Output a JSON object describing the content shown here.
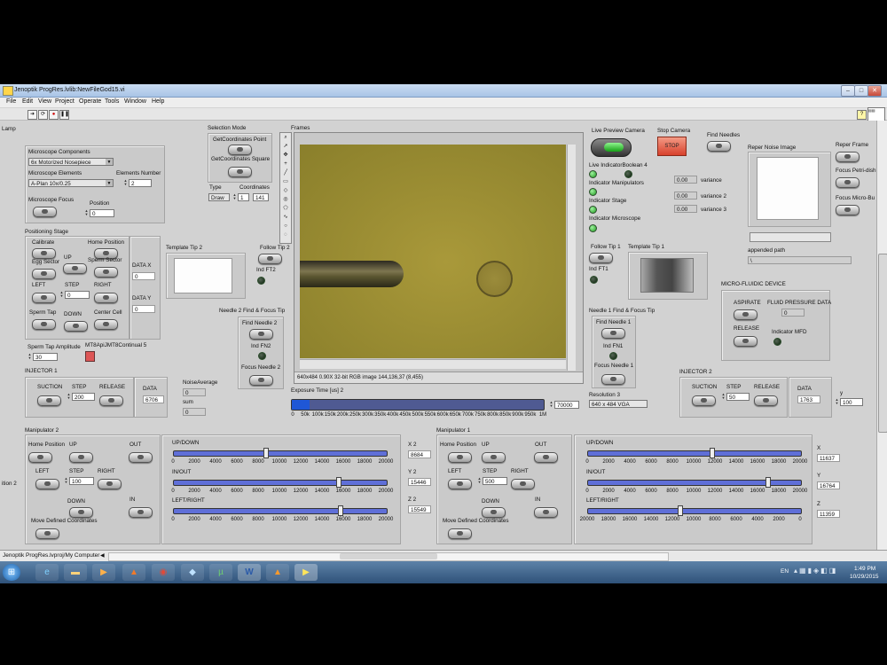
{
  "window": {
    "title": "Jenoptik ProgRes.lvlib:NewFileGod15.vi",
    "controls": {
      "min": "‒",
      "max": "□",
      "close": "✕"
    }
  },
  "menu": [
    "File",
    "Edit",
    "View",
    "Project",
    "Operate",
    "Tools",
    "Window",
    "Help"
  ],
  "toolbar": {
    "icons": [
      "run-arrow",
      "run-continuous",
      "abort",
      "pause"
    ]
  },
  "left_edge_labels": {
    "lamp": "Lamp",
    "position2": "ition 2"
  },
  "microscope": {
    "title": "Microscope Components",
    "components_value": "6x Motorized Nosepiece",
    "elements_label": "Microscope Elements",
    "elements_value": "A-Plan 10x/0.25",
    "elements_number_label": "Elements Number",
    "elements_number": "2",
    "focus_label": "Microscope Focus",
    "position_label": "Position",
    "position_value": "0"
  },
  "selection_mode": {
    "title": "Selection Mode",
    "get_point": "GetCoordinates Point",
    "get_square": "GetCoordinates Square",
    "type_label": "Type",
    "type_value": "Draw",
    "coords_label": "Coordinates",
    "coords_value": "1",
    "coords_value2": "141"
  },
  "positioning": {
    "title": "Positioning Stage",
    "calibrate": "Calibrate",
    "home_position": "Home Position",
    "up": "UP",
    "egg_sector": "Egg Sector",
    "sperm_sector": "Sperm Sector",
    "left": "LEFT",
    "step": "STEP",
    "step_value": "0",
    "right": "RIGHT",
    "sperm_tap": "Sperm Tap",
    "down": "DOWN",
    "center_cell": "Center Cell",
    "data_x_label": "DATA X",
    "data_x": "0",
    "data_y_label": "DATA Y",
    "data_y": "0",
    "amplitude_label": "Sperm Tap Amplitude",
    "amplitude_value": "30",
    "mt8_label": "MT8ApiJMT8Continual 5"
  },
  "template_tip2": {
    "title": "Template Tip 2"
  },
  "follow_tip2": {
    "title": "Follow Tip 2",
    "ind": "Ind FT2"
  },
  "needle2": {
    "title": "Needle 2 Find & Focus Tip",
    "find": "Find Needle 2",
    "ind": "Ind FN2",
    "focus": "Focus Needle 2"
  },
  "frames": {
    "title": "Frames",
    "info": "640x484 0.90X 32-bit RGB image 144,136,37",
    "coords": "(8,455)"
  },
  "exposure": {
    "title": "Exposure Time [us] 2",
    "ticks": [
      "0",
      "50k",
      "100k",
      "150k",
      "200k",
      "250k",
      "300k",
      "350k",
      "400k",
      "450k",
      "500k",
      "550k",
      "600k",
      "650k",
      "700k",
      "750k",
      "800k",
      "850k",
      "900k",
      "950k",
      "1M"
    ],
    "value": "70000",
    "fraction": 0.07
  },
  "resolution": {
    "label": "Resolution 3",
    "value": "640 x 484 VGA"
  },
  "camera": {
    "live_preview": "Live Preview Camera",
    "stop_camera": "Stop Camera",
    "stop_label": "STOP",
    "find_needles": "Find Needles",
    "live_indicator": "Live IndicatorBoolean 4",
    "ind_manipulators": "Indicator Manipulators",
    "ind_stage": "Indicator Stage",
    "ind_microscope": "Indicator Microscope",
    "variance_value1": "0.00",
    "variance_label1": "variance",
    "variance_value2": "0.00",
    "variance_label2": "variance 2",
    "variance_value3": "0.00",
    "variance_label3": "variance 3"
  },
  "follow_tip1": {
    "title": "Follow Tip 1",
    "ind": "Ind FT1"
  },
  "template_tip1": {
    "title": "Template Tip 1"
  },
  "needle1": {
    "title": "Needle 1 Find & Focus Tip",
    "find": "Find Needle 1",
    "ind": "Ind FN1",
    "focus": "Focus Needle 1"
  },
  "reper": {
    "noise_title": "Reper Noise Image",
    "reper_frame": "Reper Frame",
    "focus_petri": "Focus Petri-dish",
    "focus_micro": "Focus Micro-Bu",
    "appended_label": "appended path",
    "appended_value": "\\"
  },
  "microfluidic": {
    "title": "MICRO-FLUIDIC DEVICE",
    "aspirate": "ASPIRATE",
    "pressure_label": "FLUID PRESSURE DATA",
    "pressure_value": "0",
    "release": "RELEASE",
    "indicator": "Indicator MFD"
  },
  "injector1": {
    "title": "INJECTOR 1",
    "suction": "SUCTION",
    "step": "STEP",
    "step_value": "200",
    "release": "RELEASE",
    "data_label": "DATA",
    "data_value": "6706"
  },
  "noise": {
    "label": "NoiseAverage",
    "value": "0",
    "sum_label": "sum",
    "sum_value": "0"
  },
  "injector2": {
    "title": "INJECTOR 2",
    "suction": "SUCTION",
    "step": "STEP",
    "step_value": "50",
    "release": "RELEASE",
    "data_label": "DATA",
    "data_value": "1763",
    "y_label": "y",
    "y_value": "100"
  },
  "manip2": {
    "title": "Manipulator 2",
    "home": "Home Position",
    "up": "UP",
    "out": "OUT",
    "left": "LEFT",
    "step": "STEP",
    "step_value": "100",
    "right": "RIGHT",
    "down": "DOWN",
    "in": "IN",
    "move_defined": "Move Defined Coordinates",
    "updown_label": "UP/DOWN",
    "inout_label": "IN/OUT",
    "leftright_label": "LEFT/RIGHT",
    "ticks": [
      "0",
      "2000",
      "4000",
      "6000",
      "8000",
      "10000",
      "12000",
      "14000",
      "16000",
      "18000",
      "20000"
    ],
    "updown_fraction": 0.43,
    "inout_fraction": 0.77,
    "leftright_fraction": 0.78,
    "x_label": "X 2",
    "x_value": "8684",
    "y_label": "Y 2",
    "y_value": "15446",
    "z_label": "Z 2",
    "z_value": "15549"
  },
  "manip1": {
    "title": "Manipulator 1",
    "home": "Home Position",
    "up": "UP",
    "out": "OUT",
    "left": "LEFT",
    "step": "STEP",
    "step_value": "500",
    "right": "RIGHT",
    "down": "DOWN",
    "in": "IN",
    "move_defined": "Move Defined Coordinates",
    "updown_label": "UP/DOWN",
    "inout_label": "IN/OUT",
    "leftright_label": "LEFT/RIGHT",
    "ticks": [
      "0",
      "2000",
      "4000",
      "6000",
      "8000",
      "10000",
      "12000",
      "14000",
      "16000",
      "18000",
      "20000"
    ],
    "ticks_reverse": [
      "20000",
      "18000",
      "16000",
      "14000",
      "12000",
      "10000",
      "8000",
      "6000",
      "4000",
      "2000",
      "0"
    ],
    "updown_fraction": 0.58,
    "inout_fraction": 0.84,
    "leftright_fraction": 0.43,
    "x_label": "X",
    "x_value": "11637",
    "y_label": "Y",
    "y_value": "16764",
    "z_label": "Z",
    "z_value": "11359"
  },
  "statusbar": {
    "path": "Jenoptik ProgRes.lvproj/My Computer"
  },
  "taskbar": {
    "lang": "EN",
    "time": "1:49 PM",
    "date": "10/29/2015",
    "apps": [
      "windows-orb",
      "ie-icon",
      "explorer-icon",
      "media-player-icon",
      "matlab-icon",
      "chrome-icon",
      "tool-icon",
      "utorrent-icon",
      "word-icon",
      "vlc-icon",
      "labview-icon"
    ]
  }
}
